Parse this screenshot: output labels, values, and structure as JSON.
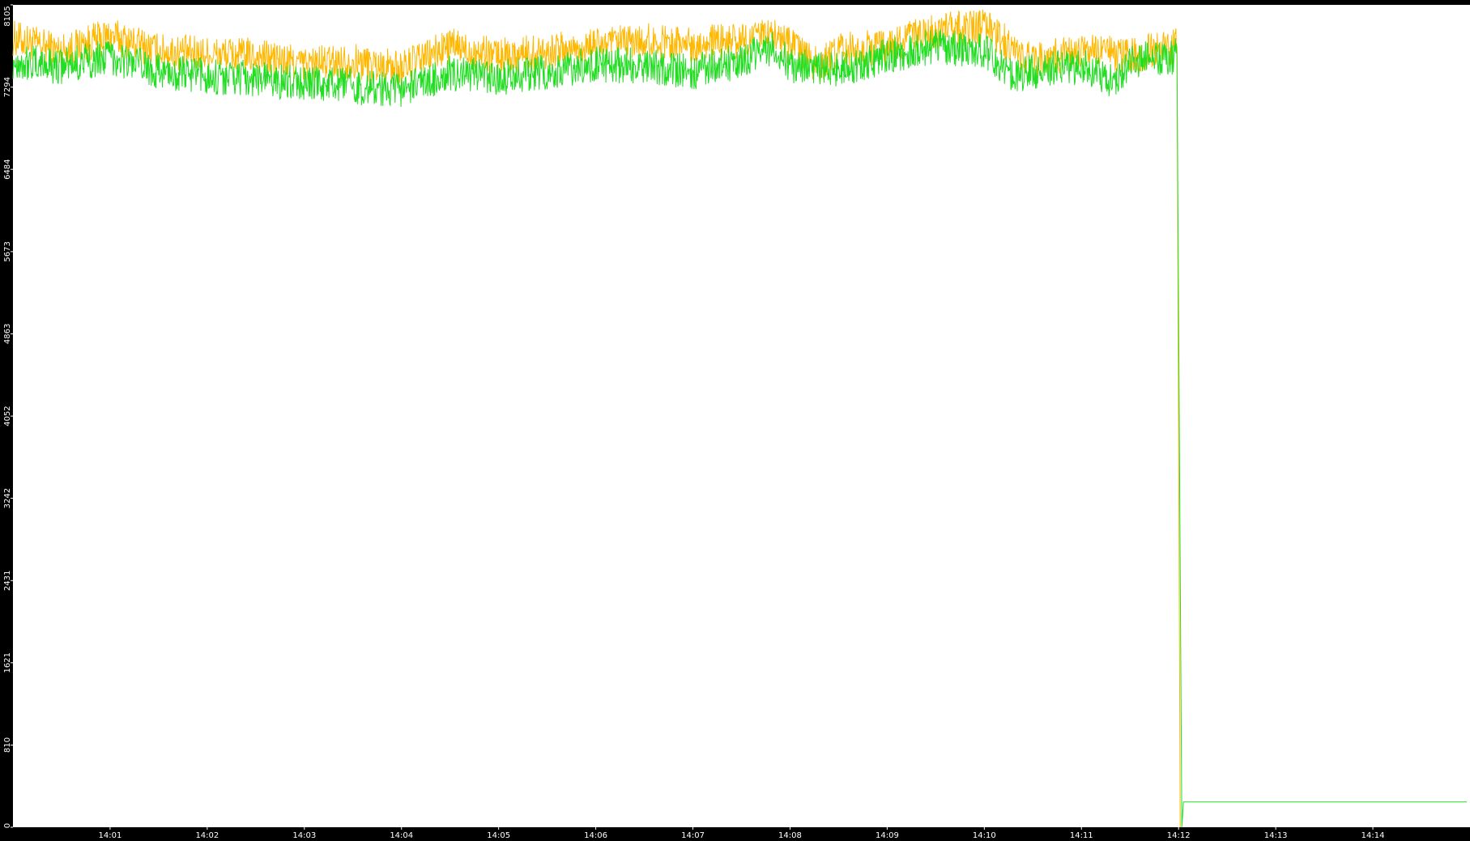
{
  "chart_data": {
    "type": "line",
    "title": "",
    "xlabel": "",
    "ylabel": "",
    "ylim": [
      0,
      8105
    ],
    "xlim": [
      "14:00:00",
      "14:15:00"
    ],
    "y_ticks": [
      0,
      810,
      1621,
      2431,
      3242,
      4052,
      4863,
      5673,
      6484,
      7294,
      8105
    ],
    "x_ticks": [
      "14:01",
      "14:02",
      "14:03",
      "14:04",
      "14:05",
      "14:06",
      "14:07",
      "14:08",
      "14:09",
      "14:10",
      "14:11",
      "14:12",
      "14:13",
      "14:14"
    ],
    "grid": false,
    "legend": "none",
    "colors": {
      "background": "#ffffff",
      "axis": "#000000",
      "tick_label": "#ffffff"
    },
    "series": [
      {
        "color": "#ffb800",
        "x": [
          "14:00:00",
          "14:00:30",
          "14:01:00",
          "14:01:30",
          "14:02:00",
          "14:02:30",
          "14:03:00",
          "14:03:30",
          "14:04:00",
          "14:04:30",
          "14:05:00",
          "14:05:30",
          "14:06:00",
          "14:06:30",
          "14:07:00",
          "14:07:30",
          "14:07:50",
          "14:08:00",
          "14:08:18",
          "14:08:30",
          "14:09:00",
          "14:09:30",
          "14:10:00",
          "14:10:20",
          "14:10:30",
          "14:11:00",
          "14:11:30",
          "14:11:59",
          "14:12:00",
          "14:12:01"
        ],
        "y": [
          7780,
          7650,
          7800,
          7650,
          7620,
          7600,
          7520,
          7550,
          7480,
          7700,
          7600,
          7650,
          7700,
          7750,
          7720,
          7750,
          7820,
          7700,
          7500,
          7650,
          7700,
          7850,
          7900,
          7650,
          7550,
          7650,
          7600,
          7700,
          3850,
          0
        ]
      },
      {
        "color": "#22dd22",
        "x": [
          "14:00:00",
          "14:00:30",
          "14:01:00",
          "14:01:30",
          "14:02:00",
          "14:02:30",
          "14:03:00",
          "14:03:30",
          "14:04:00",
          "14:04:30",
          "14:05:00",
          "14:05:30",
          "14:06:00",
          "14:06:30",
          "14:07:00",
          "14:07:30",
          "14:07:50",
          "14:08:00",
          "14:08:30",
          "14:09:00",
          "14:09:30",
          "14:10:00",
          "14:10:20",
          "14:10:30",
          "14:11:00",
          "14:11:20",
          "14:11:30",
          "14:11:59",
          "14:12:02",
          "14:12:03",
          "14:14:58"
        ],
        "y": [
          7550,
          7500,
          7600,
          7450,
          7400,
          7380,
          7330,
          7300,
          7260,
          7430,
          7380,
          7450,
          7520,
          7500,
          7450,
          7550,
          7700,
          7500,
          7480,
          7600,
          7700,
          7650,
          7400,
          7450,
          7500,
          7350,
          7550,
          7600,
          0,
          250,
          250
        ]
      }
    ]
  }
}
